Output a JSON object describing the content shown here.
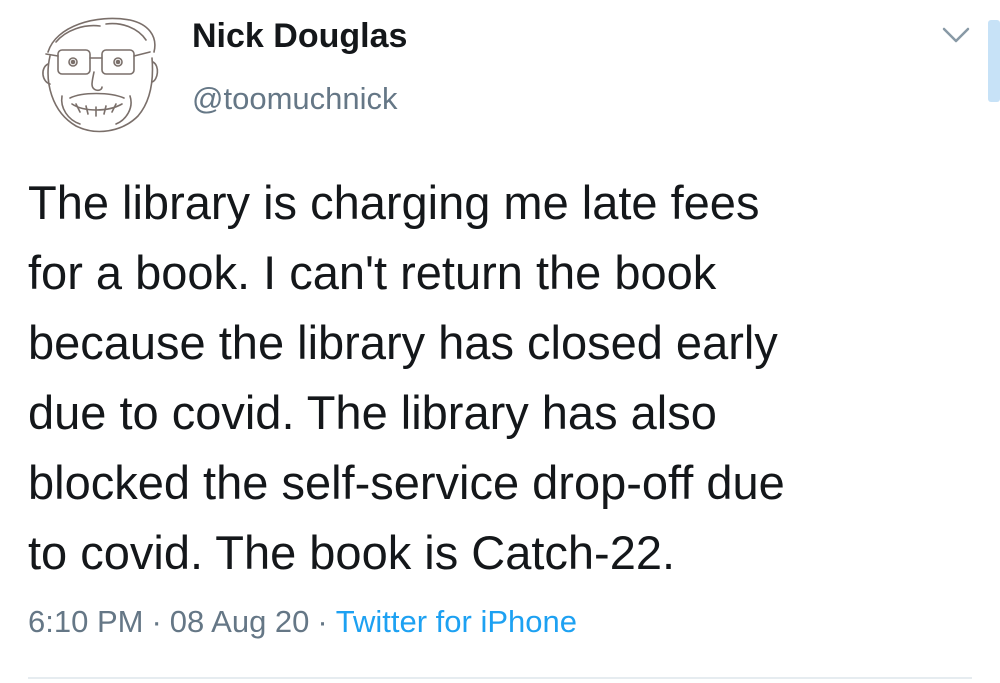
{
  "author": {
    "name": "Nick Douglas",
    "handle": "@toomuchnick",
    "avatar_icon": "sketched-face-avatar"
  },
  "tweet": {
    "text": "The library is charging me late fees\nfor a book. I can't return the book\nbecause the library has closed early\ndue to covid. The library has also\nblocked the self-service drop-off due\nto covid. The book is Catch-22.",
    "time": "6:10 PM",
    "separator": "·",
    "date": "08 Aug 20",
    "source": "Twitter for iPhone"
  },
  "menu": {
    "caret_icon": "chevron-down-icon"
  },
  "colors": {
    "text": "#14171a",
    "secondary": "#657786",
    "link": "#1da1f2",
    "divider": "#e6ecf0"
  }
}
